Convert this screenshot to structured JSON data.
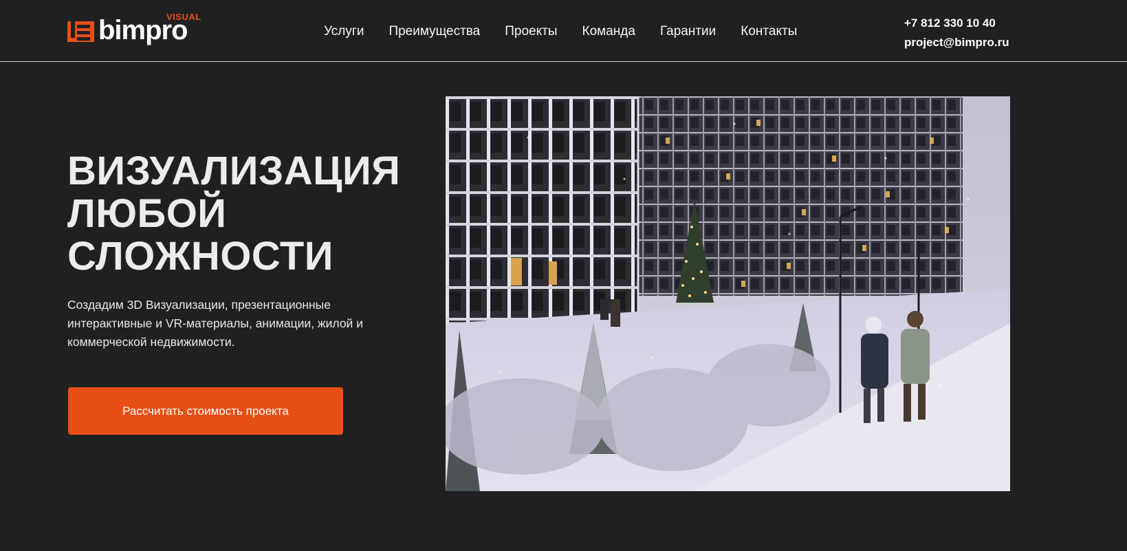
{
  "brand": {
    "name": "bimpro",
    "superscript": "VISUAL",
    "accent_color": "#e84f17"
  },
  "nav": {
    "items": [
      {
        "label": "Услуги"
      },
      {
        "label": "Преимущества"
      },
      {
        "label": "Проекты"
      },
      {
        "label": "Команда"
      },
      {
        "label": "Гарантии"
      },
      {
        "label": "Контакты"
      }
    ]
  },
  "contacts": {
    "phone": "+7 812 330 10 40",
    "email": "project@bimpro.ru"
  },
  "hero": {
    "title_lines": [
      "ВИЗУАЛИЗАЦИЯ",
      "ЛЮБОЙ",
      "СЛОЖНОСТИ"
    ],
    "description": "Создадим 3D Визуализации, презентационные интерактивные и VR-материалы, анимации, жилой и коммерческой недвижимости.",
    "cta_label": "Рассчитать стоимость проекта",
    "image_subject": "winter-residential-courtyard-render"
  }
}
